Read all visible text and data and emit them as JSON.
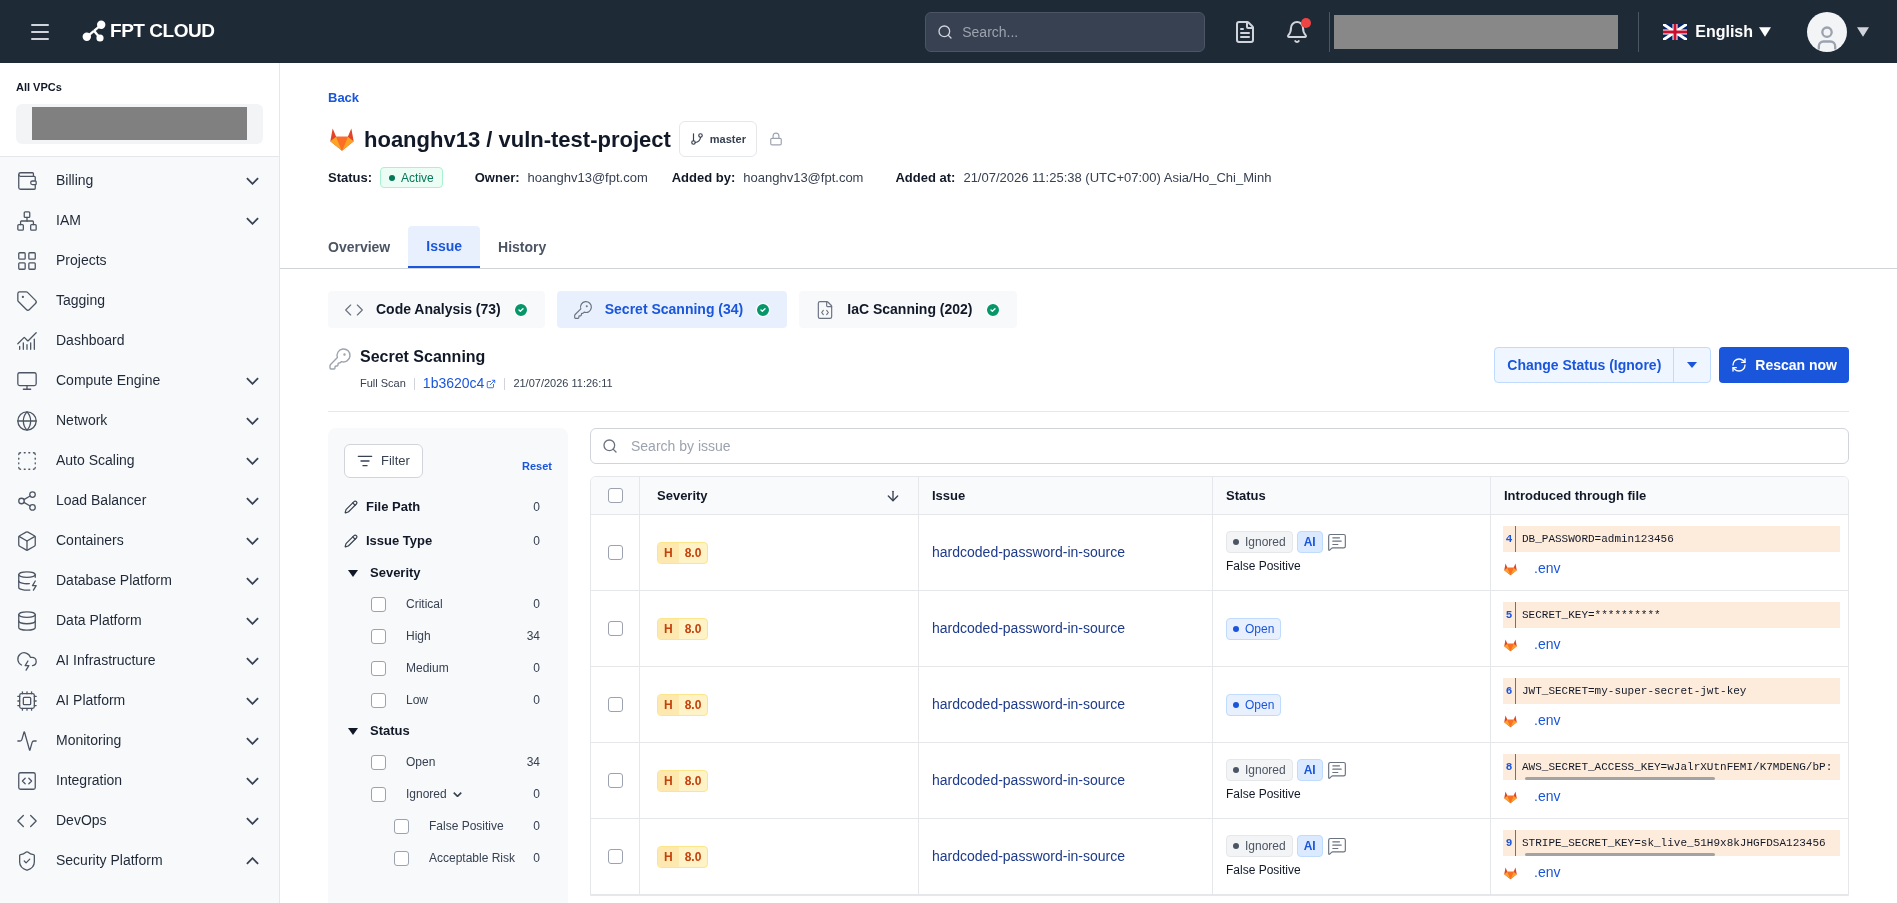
{
  "topbar": {
    "brand": "FPT CLOUD",
    "search": {
      "placeholder": "Search..."
    },
    "notification": true,
    "language": "English"
  },
  "sidebar": {
    "vpc_label": "All VPCs",
    "items": [
      {
        "label": "Billing",
        "expanded": false
      },
      {
        "label": "IAM",
        "expanded": false
      },
      {
        "label": "Projects"
      },
      {
        "label": "Tagging"
      },
      {
        "label": "Dashboard"
      },
      {
        "label": "Compute Engine",
        "expanded": false
      },
      {
        "label": "Network",
        "expanded": false
      },
      {
        "label": "Auto Scaling",
        "expanded": false
      },
      {
        "label": "Load Balancer",
        "expanded": false
      },
      {
        "label": "Containers",
        "expanded": false
      },
      {
        "label": "Database Platform",
        "expanded": false
      },
      {
        "label": "Data Platform",
        "expanded": false
      },
      {
        "label": "AI Infrastructure",
        "expanded": false
      },
      {
        "label": "AI Platform",
        "expanded": false
      },
      {
        "label": "Monitoring",
        "expanded": false
      },
      {
        "label": "Integration",
        "expanded": false
      },
      {
        "label": "DevOps",
        "expanded": false
      },
      {
        "label": "Security Platform",
        "expanded": true
      }
    ]
  },
  "header": {
    "back": "Back",
    "title": "hoanghv13 / vuln-test-project",
    "branch": "master",
    "meta": [
      {
        "label": "Status:",
        "value": "Active",
        "kind": "badge"
      },
      {
        "label": "Owner:",
        "value": "hoanghv13@fpt.com",
        "kind": "text"
      },
      {
        "label": "Added by:",
        "value": "hoanghv13@fpt.com",
        "kind": "text"
      },
      {
        "label": "Added at:",
        "value": "21/07/2026 11:25:38 (UTC+07:00) Asia/Ho_Chi_Minh",
        "kind": "text"
      }
    ]
  },
  "tabs": [
    {
      "label": "Overview",
      "selected": false
    },
    {
      "label": "Issue",
      "selected": true
    },
    {
      "label": "History",
      "selected": false
    }
  ],
  "scan_tabs": [
    {
      "label": "Code Analysis (73)",
      "selected": false,
      "done": true
    },
    {
      "label": "Secret Scanning (34)",
      "selected": true,
      "done": true
    },
    {
      "label": "IaC Scanning (202)",
      "selected": false,
      "done": true
    }
  ],
  "scan": {
    "title": "Secret Scanning",
    "type": "Full Scan",
    "commit": "1b3620c4",
    "time": "21/07/2026 11:26:11",
    "change_status": "Change Status (Ignore)",
    "rescan": "Rescan now"
  },
  "filter": {
    "button": "Filter",
    "reset": "Reset",
    "fields": [
      {
        "label": "File Path",
        "count": "0"
      },
      {
        "label": "Issue Type",
        "count": "0"
      }
    ],
    "groups": [
      {
        "label": "Severity",
        "expanded": true,
        "options": [
          {
            "label": "Critical",
            "count": "0",
            "checked": false
          },
          {
            "label": "High",
            "count": "34",
            "checked": false
          },
          {
            "label": "Medium",
            "count": "0",
            "checked": false
          },
          {
            "label": "Low",
            "count": "0",
            "checked": false
          }
        ]
      },
      {
        "label": "Status",
        "expanded": true,
        "options": [
          {
            "label": "Open",
            "count": "34",
            "checked": false
          },
          {
            "label": "Ignored",
            "count": "0",
            "checked": false,
            "expanded": true,
            "children": [
              {
                "label": "False Positive",
                "count": "0",
                "checked": false
              },
              {
                "label": "Acceptable Risk",
                "count": "0",
                "checked": false
              }
            ]
          }
        ]
      }
    ]
  },
  "table": {
    "search": {
      "placeholder": "Search by issue"
    },
    "select_all": {
      "checked": false
    },
    "columns": [
      "Severity",
      "Issue",
      "Status",
      "Introduced through file"
    ],
    "rows": [
      {
        "checked": false,
        "sev": "H",
        "score": "8.0",
        "issue": "hardcoded-password-in-source",
        "status": {
          "kind": "ignored",
          "label": "Ignored",
          "ai": "AI",
          "reason": "False Positive"
        },
        "line": "4",
        "code": "DB_PASSWORD=admin123456",
        "scrollbar": false,
        "file": ".env"
      },
      {
        "checked": false,
        "sev": "H",
        "score": "8.0",
        "issue": "hardcoded-password-in-source",
        "status": {
          "kind": "open",
          "label": "Open"
        },
        "line": "5",
        "code": "SECRET_KEY=**********",
        "scrollbar": false,
        "file": ".env"
      },
      {
        "checked": false,
        "sev": "H",
        "score": "8.0",
        "issue": "hardcoded-password-in-source",
        "status": {
          "kind": "open",
          "label": "Open"
        },
        "line": "6",
        "code": "JWT_SECRET=my-super-secret-jwt-key",
        "scrollbar": false,
        "file": ".env"
      },
      {
        "checked": false,
        "sev": "H",
        "score": "8.0",
        "issue": "hardcoded-password-in-source",
        "status": {
          "kind": "ignored",
          "label": "Ignored",
          "ai": "AI",
          "reason": "False Positive"
        },
        "line": "8",
        "code": "AWS_SECRET_ACCESS_KEY=wJalrXUtnFEMI/K7MDENG/bP:",
        "scrollbar": true,
        "file": ".env"
      },
      {
        "checked": false,
        "sev": "H",
        "score": "8.0",
        "issue": "hardcoded-password-in-source",
        "status": {
          "kind": "ignored",
          "label": "Ignored",
          "ai": "AI",
          "reason": "False Positive"
        },
        "line": "9",
        "code": "STRIPE_SECRET_KEY=sk_live_51H9x8kJHGFDSA123456",
        "scrollbar": true,
        "file": ".env"
      }
    ]
  }
}
